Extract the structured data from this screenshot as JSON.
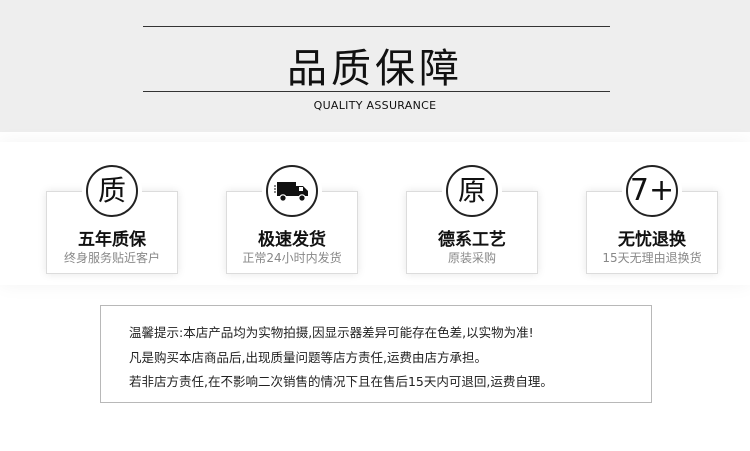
{
  "header": {
    "title": "品质保障",
    "subtitle": "QUALITY ASSURANCE"
  },
  "features": [
    {
      "badge": "质",
      "badge_icon": "",
      "name": "五年质保",
      "desc": "终身服务贴近客户"
    },
    {
      "badge": "",
      "badge_icon": "truck-icon",
      "name": "极速发货",
      "desc": "正常24小时内发货"
    },
    {
      "badge": "原",
      "badge_icon": "",
      "name": "德系工艺",
      "desc": "原装采购"
    },
    {
      "badge": "7+",
      "badge_icon": "",
      "name": "无忧退换",
      "desc": "15天无理由退换货"
    }
  ],
  "notice": {
    "line1": "温馨提示:本店产品均为实物拍摄,因显示器差异可能存在色差,以实物为准!",
    "line2": "凡是购买本店商品后,出现质量问题等店方责任,运费由店方承担。",
    "line3": "若非店方责任,在不影响二次销售的情况下且在售后15天内可退回,运费自理。"
  }
}
